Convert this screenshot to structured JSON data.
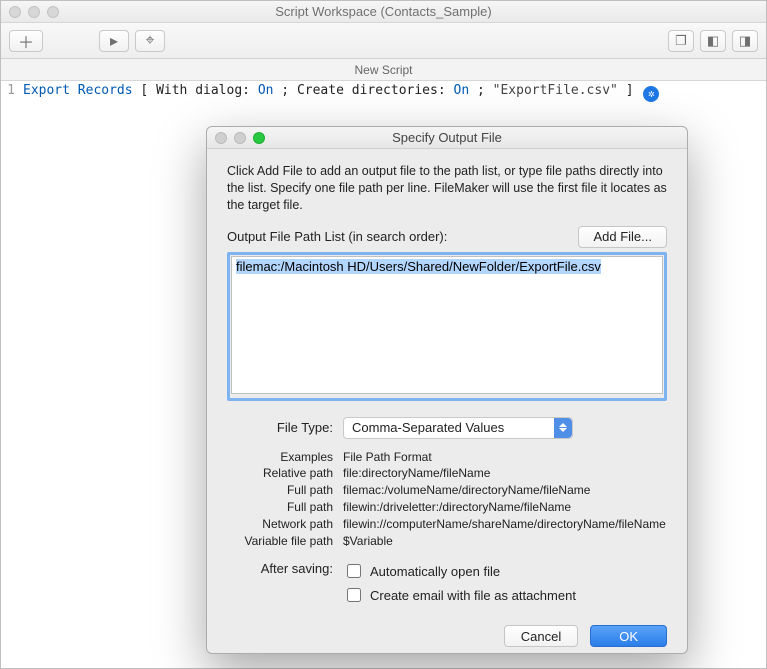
{
  "window": {
    "title": "Script Workspace (Contacts_Sample)"
  },
  "tab": {
    "label": "New Script"
  },
  "script": {
    "line_number": "1",
    "step_name": "Export Records",
    "with_dialog_label": "With dialog:",
    "with_dialog_value": "On",
    "create_dirs_label": "Create directories:",
    "create_dirs_value": "On",
    "filename": "\"ExportFile.csv\""
  },
  "dialog": {
    "title": "Specify Output File",
    "instructions": "Click Add File to add an output file to the path list, or type file paths directly into the list. Specify one file path per line. FileMaker will use the first file it locates as the target file.",
    "path_list_label": "Output File Path List (in search order):",
    "add_file_button": "Add File...",
    "path_value": "filemac:/Macintosh HD/Users/Shared/NewFolder/ExportFile.csv",
    "file_type_label": "File Type:",
    "file_type_value": "Comma-Separated Values",
    "examples": {
      "header_label": "Examples",
      "header_value": "File Path Format",
      "relative_label": "Relative path",
      "relative_value": "file:directoryName/fileName",
      "fullmac_label": "Full path",
      "fullmac_value": "filemac:/volumeName/directoryName/fileName",
      "fullwin_label": "Full path",
      "fullwin_value": "filewin:/driveletter:/directoryName/fileName",
      "network_label": "Network path",
      "network_value": "filewin://computerName/shareName/directoryName/fileName",
      "variable_label": "Variable file path",
      "variable_value": "$Variable"
    },
    "after_saving_label": "After saving:",
    "auto_open_label": "Automatically open file",
    "create_email_label": "Create email with file as attachment",
    "cancel_button": "Cancel",
    "ok_button": "OK"
  }
}
